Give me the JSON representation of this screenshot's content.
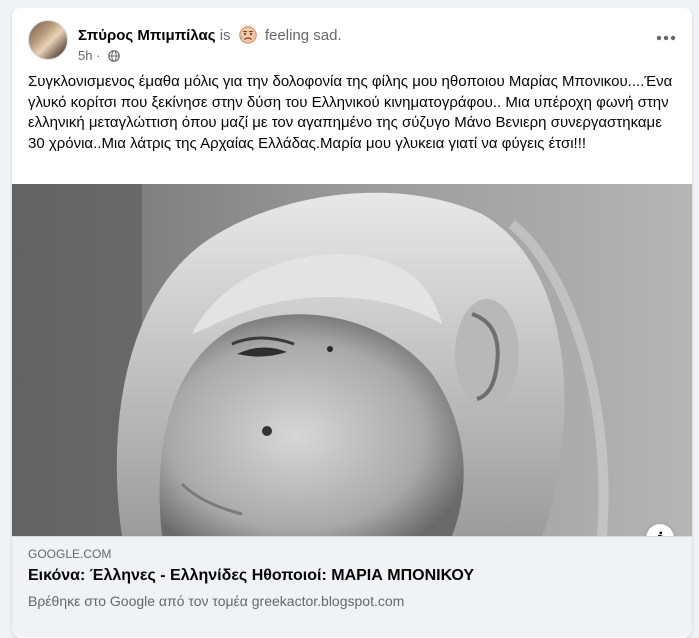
{
  "post": {
    "author": "Σπύρος Μπιμπίλας",
    "is_word": "is",
    "feeling": "feeling sad.",
    "feeling_icon": "sad-face-emoji-icon",
    "time": "5h",
    "audience_icon": "globe-icon",
    "more_icon": "more-options-icon",
    "text": "Συγκλονισμενος έμαθα μόλις για την δολοφονία της φίλης μου  ηθοποιου Μαρίας Μπονικου....Ένα γλυκό κορίτσι που ξεκίνησε στην δύση του Ελληνικού κινηματογράφου.. Μια υπέροχη φωνή στην ελληνική μεταγλώττιση όπου μαζί με τον αγαπημένο της σύζυγο Μάνο Βενιερη συνεργαστηκαμε 30 χρόνια..Μια λάτρις της Αρχαίας Ελλάδας.Μαρία μου γλυκεια γιατί να φύγεις έτσι!!!"
  },
  "link": {
    "domain": "GOOGLE.COM",
    "title": "Εικόνα: Έλληνες - Ελληνίδες Ηθοποιοί: ΜΑΡΙΑ ΜΠΟΝΙΚΟΥ",
    "description": "Βρέθηκε στο Google από τον τομέα greekactor.blogspot.com",
    "info_label": "i"
  },
  "colors": {
    "background": "#f0f2f5",
    "card": "#ffffff",
    "secondary_text": "#65676b",
    "primary_text": "#050505"
  }
}
